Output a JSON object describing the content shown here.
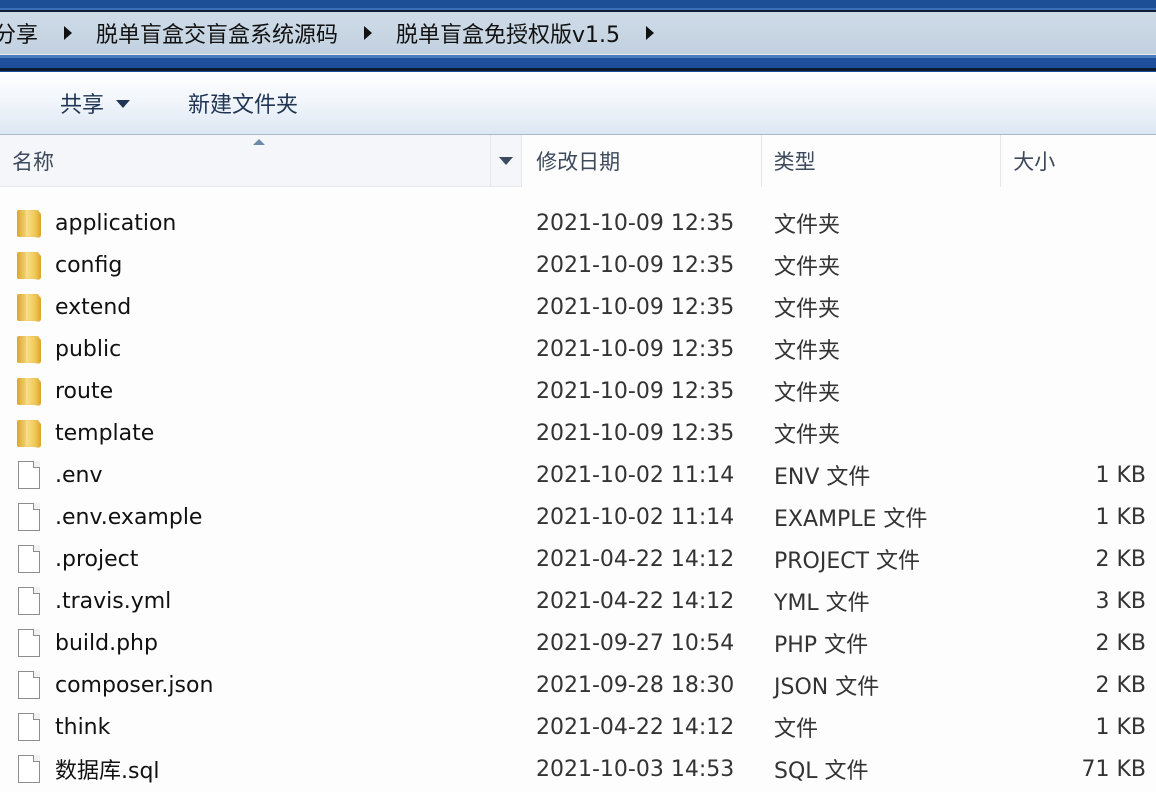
{
  "breadcrumb": [
    {
      "label": "分享"
    },
    {
      "label": "脱单盲盒交盲盒系统源码"
    },
    {
      "label": "脱单盲盒免授权版v1.5"
    }
  ],
  "toolbar": {
    "share_label": "共享",
    "new_folder_label": "新建文件夹"
  },
  "columns": {
    "name": "名称",
    "date": "修改日期",
    "type": "类型",
    "size": "大小"
  },
  "files": [
    {
      "name": "application",
      "date": "2021-10-09 12:35",
      "type": "文件夹",
      "size": "",
      "icon": "folder-icon"
    },
    {
      "name": "config",
      "date": "2021-10-09 12:35",
      "type": "文件夹",
      "size": "",
      "icon": "folder-icon"
    },
    {
      "name": "extend",
      "date": "2021-10-09 12:35",
      "type": "文件夹",
      "size": "",
      "icon": "folder-icon"
    },
    {
      "name": "public",
      "date": "2021-10-09 12:35",
      "type": "文件夹",
      "size": "",
      "icon": "folder-icon"
    },
    {
      "name": "route",
      "date": "2021-10-09 12:35",
      "type": "文件夹",
      "size": "",
      "icon": "folder-icon"
    },
    {
      "name": "template",
      "date": "2021-10-09 12:35",
      "type": "文件夹",
      "size": "",
      "icon": "folder-icon"
    },
    {
      "name": ".env",
      "date": "2021-10-02 11:14",
      "type": "ENV 文件",
      "size": "1 KB",
      "icon": "file-icon"
    },
    {
      "name": ".env.example",
      "date": "2021-10-02 11:14",
      "type": "EXAMPLE 文件",
      "size": "1 KB",
      "icon": "file-icon"
    },
    {
      "name": ".project",
      "date": "2021-04-22 14:12",
      "type": "PROJECT 文件",
      "size": "2 KB",
      "icon": "file-icon"
    },
    {
      "name": ".travis.yml",
      "date": "2021-04-22 14:12",
      "type": "YML 文件",
      "size": "3 KB",
      "icon": "file-icon"
    },
    {
      "name": "build.php",
      "date": "2021-09-27 10:54",
      "type": "PHP 文件",
      "size": "2 KB",
      "icon": "file-icon"
    },
    {
      "name": "composer.json",
      "date": "2021-09-28 18:30",
      "type": "JSON 文件",
      "size": "2 KB",
      "icon": "file-icon"
    },
    {
      "name": "think",
      "date": "2021-04-22 14:12",
      "type": "文件",
      "size": "1 KB",
      "icon": "file-icon"
    },
    {
      "name": "数据库.sql",
      "date": "2021-10-03 14:53",
      "type": "SQL 文件",
      "size": "71 KB",
      "icon": "file-icon"
    }
  ]
}
